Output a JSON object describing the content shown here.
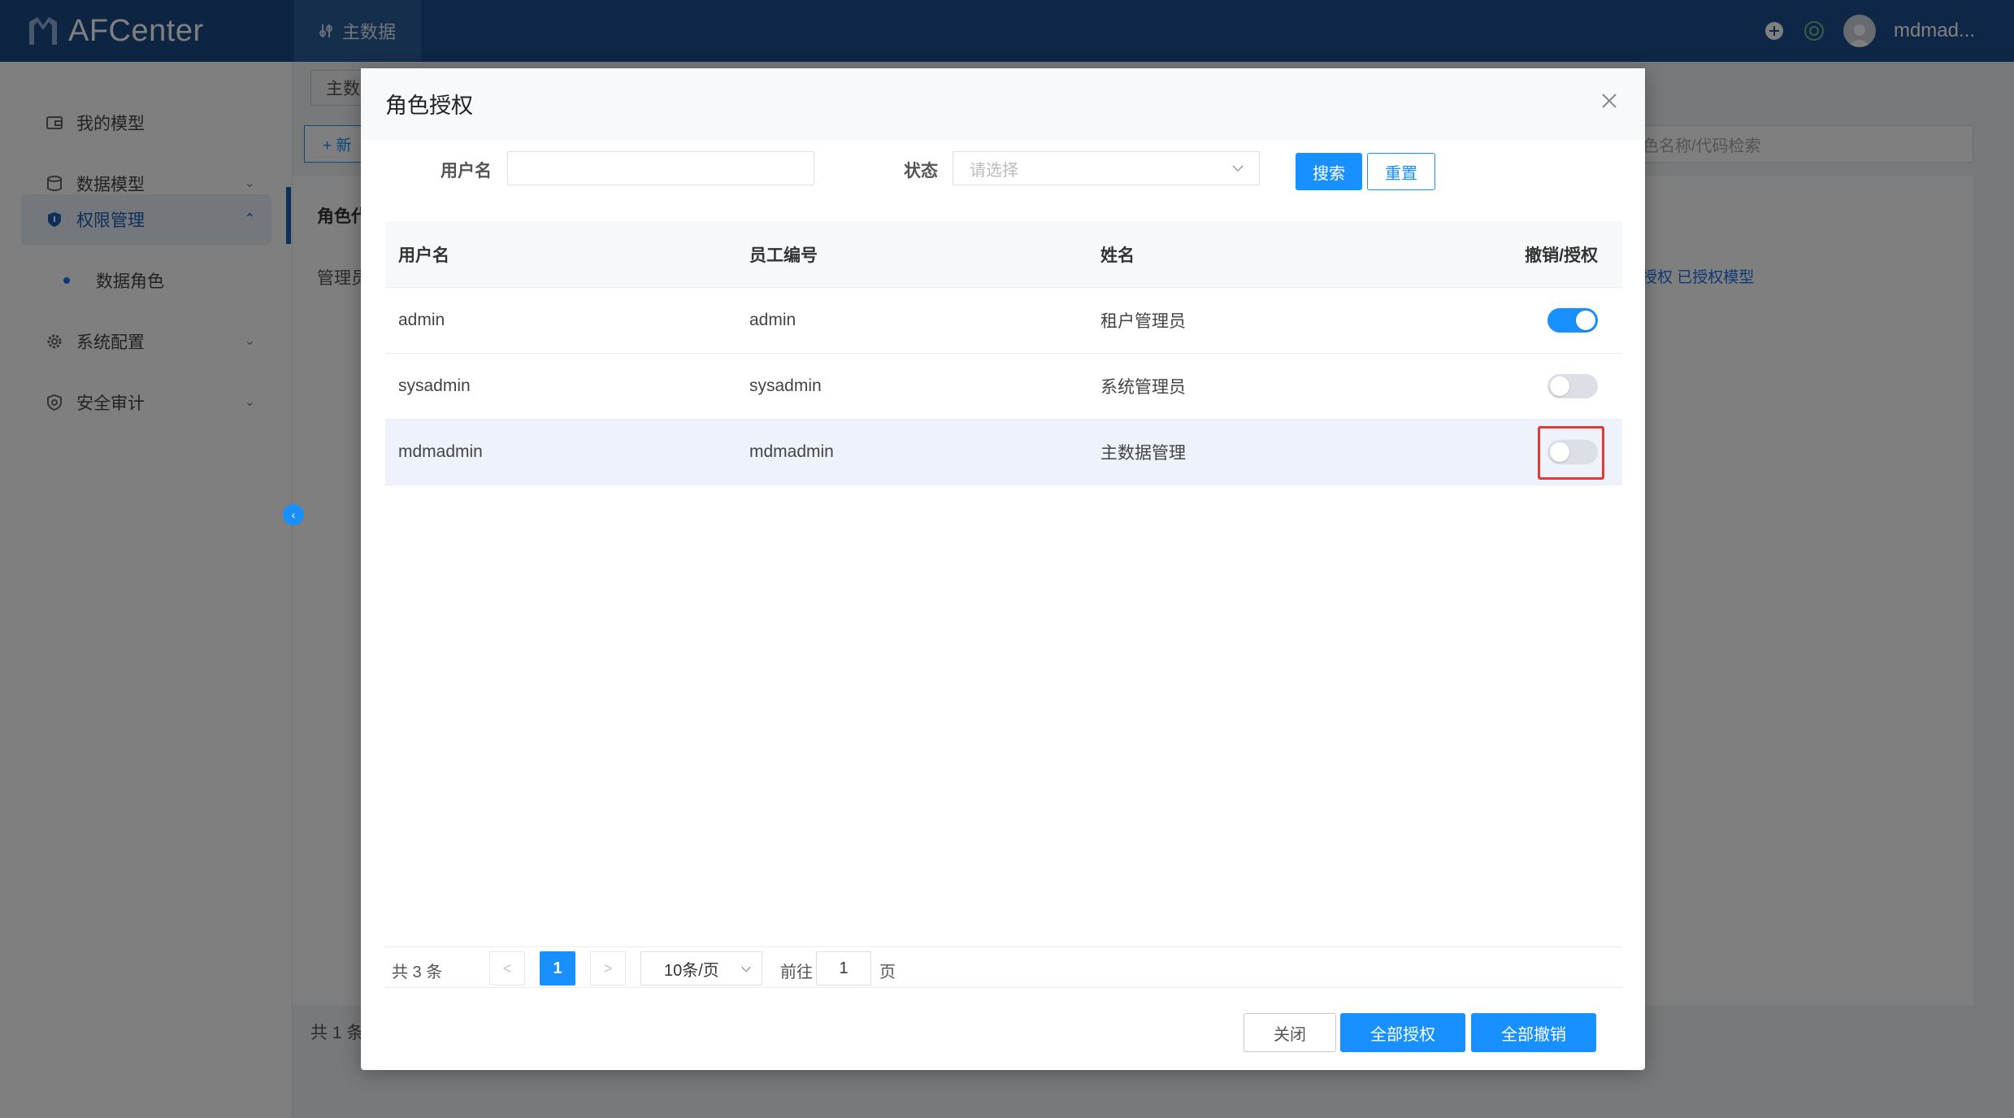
{
  "app": {
    "name": "AFCenter"
  },
  "topbar": {
    "tab_label": "主数据",
    "user_name": "mdmad..."
  },
  "sidebar": {
    "items": [
      {
        "label": "我的模型"
      },
      {
        "label": "数据模型"
      },
      {
        "label": "权限管理"
      },
      {
        "label": "系统配置"
      },
      {
        "label": "安全审计"
      }
    ],
    "sub_items": [
      {
        "label": "数据角色"
      }
    ]
  },
  "background": {
    "tag": "主数",
    "new_button": "+ 新",
    "search_placeholder": "色名称/代码检索",
    "table_header": "角色代",
    "row_text": "管理员",
    "links": "授权  已授权模型",
    "total": "共 1 条"
  },
  "dialog": {
    "title": "角色授权",
    "filters": {
      "username_label": "用户名",
      "username_value": "",
      "status_label": "状态",
      "status_placeholder": "请选择",
      "search_button": "搜索",
      "reset_button": "重置"
    },
    "table": {
      "columns": [
        "用户名",
        "员工编号",
        "姓名",
        "撤销/授权"
      ],
      "rows": [
        {
          "username": "admin",
          "employee_id": "admin",
          "name": "租户管理员",
          "authorized": true
        },
        {
          "username": "sysadmin",
          "employee_id": "sysadmin",
          "name": "系统管理员",
          "authorized": false
        },
        {
          "username": "mdmadmin",
          "employee_id": "mdmadmin",
          "name": "主数据管理",
          "authorized": false
        }
      ]
    },
    "pagination": {
      "total": "共 3 条",
      "current_page": "1",
      "page_size": "10条/页",
      "goto_prefix": "前往",
      "goto_value": "1",
      "goto_suffix": "页",
      "prev_icon": "<",
      "next_icon": ">"
    },
    "footer": {
      "close_button": "关闭",
      "grant_all_button": "全部授权",
      "revoke_all_button": "全部撤销"
    }
  },
  "colors": {
    "primary": "#1890ff",
    "topbar": "#1c4f8c",
    "highlight_border": "#e53935"
  }
}
